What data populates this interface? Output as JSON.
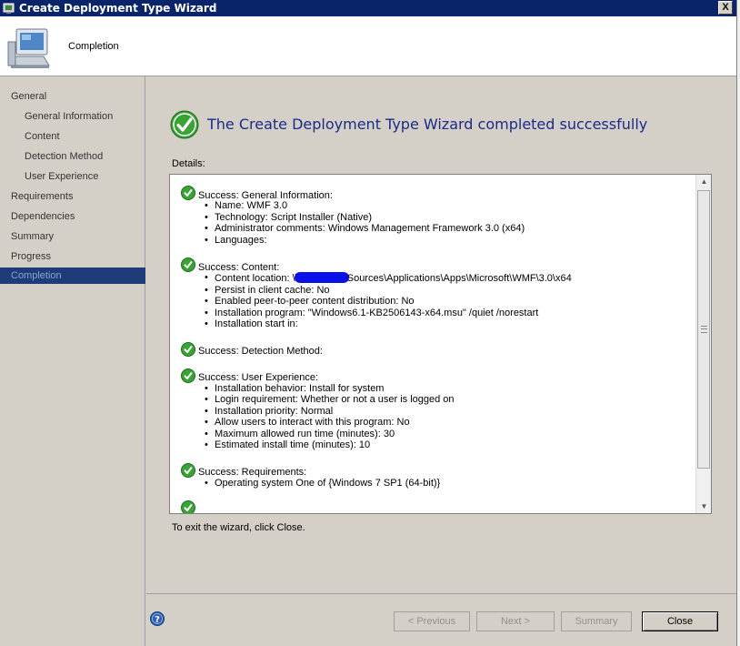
{
  "window": {
    "title": "Create Deployment Type Wizard",
    "close_glyph": "X"
  },
  "header": {
    "title": "Completion"
  },
  "sidebar": {
    "items": [
      {
        "label": "General",
        "level": 0
      },
      {
        "label": "General Information",
        "level": 1
      },
      {
        "label": "Content",
        "level": 1
      },
      {
        "label": "Detection Method",
        "level": 1
      },
      {
        "label": "User Experience",
        "level": 1
      },
      {
        "label": "Requirements",
        "level": 0
      },
      {
        "label": "Dependencies",
        "level": 0
      },
      {
        "label": "Summary",
        "level": 0
      },
      {
        "label": "Progress",
        "level": 0
      },
      {
        "label": "Completion",
        "level": 0,
        "active": true
      }
    ]
  },
  "main": {
    "heading": "The Create Deployment Type Wizard completed successfully",
    "details_label": "Details:",
    "exit_text": "To exit the wizard, click Close."
  },
  "details": {
    "sections": [
      {
        "title": "Success: General Information:",
        "items": [
          "Name: WMF 3.0",
          "Technology: Script Installer (Native)",
          "Administrator comments:  Windows Management Framework 3.0 (x64)",
          "Languages:"
        ]
      },
      {
        "title": "Success: Content:",
        "content_location_prefix": "Content location: \\\\",
        "content_location_suffix": "Sources\\Applications\\Apps\\Microsoft\\WMF\\3.0\\x64",
        "items": [
          "Persist in client cache: No",
          "Enabled peer-to-peer content distribution: No",
          "Installation program: \"Windows6.1-KB2506143-x64.msu\" /quiet /norestart",
          "Installation start in:"
        ]
      },
      {
        "title": "Success: Detection Method:",
        "items": []
      },
      {
        "title": "Success: User Experience:",
        "items": [
          "Installation behavior: Install for system",
          "Login requirement: Whether or not a user is logged on",
          "Installation priority: Normal",
          "Allow users to interact with this program: No",
          "Maximum allowed run time (minutes): 30",
          "Estimated install time (minutes): 10"
        ]
      },
      {
        "title": "Success: Requirements:",
        "items": [
          "Operating system  One of  {Windows 7 SP1 (64-bit)}"
        ]
      }
    ]
  },
  "buttons": {
    "previous": "< Previous",
    "next": "Next >",
    "summary": "Summary",
    "close": "Close"
  },
  "colors": {
    "title_bar": "#0a246a",
    "heading": "#1a2a8a",
    "active_nav": "#1f3c7a",
    "success_green": "#3aa335"
  }
}
